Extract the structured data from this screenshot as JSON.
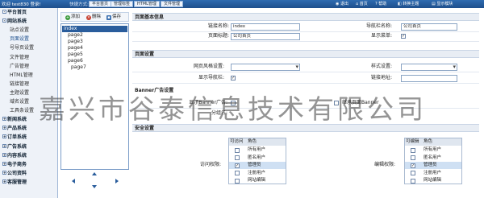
{
  "topbar": {
    "welcome": "欢迎 test830 登录!",
    "quick_label": "快捷方式:",
    "tabs": [
      "平台首页",
      "管理标签",
      "HTML管理",
      "文件管理"
    ],
    "right": [
      "退出",
      "首页",
      "帮助",
      "转换主题",
      "显示模块"
    ]
  },
  "leftnav": {
    "items": [
      {
        "label": "平台首页",
        "type": "top",
        "state": "-"
      },
      {
        "label": "网站系统",
        "type": "top",
        "state": "-"
      },
      {
        "label": "站点设置",
        "type": "sub"
      },
      {
        "label": "页面设置",
        "type": "sub",
        "selected": true
      },
      {
        "label": "号导页设置",
        "type": "sub"
      },
      {
        "label": "文件管理",
        "type": "sub"
      },
      {
        "label": "广告管理",
        "type": "sub"
      },
      {
        "label": "HTML管理",
        "type": "sub"
      },
      {
        "label": "链接管理",
        "type": "sub"
      },
      {
        "label": "主题设置",
        "type": "sub"
      },
      {
        "label": "域名设置",
        "type": "sub"
      },
      {
        "label": "工具条设置",
        "type": "sub"
      },
      {
        "label": "新闻系统",
        "type": "top",
        "state": "+"
      },
      {
        "label": "产品系统",
        "type": "top",
        "state": "+"
      },
      {
        "label": "订单系统",
        "type": "top",
        "state": "+"
      },
      {
        "label": "广告系统",
        "type": "top",
        "state": "+"
      },
      {
        "label": "内容系统",
        "type": "top",
        "state": "+"
      },
      {
        "label": "电子商务",
        "type": "top",
        "state": "+"
      },
      {
        "label": "公司资料",
        "type": "top",
        "state": "+"
      },
      {
        "label": "客服管理",
        "type": "top",
        "state": "+"
      }
    ]
  },
  "toolbar": {
    "add": "添加",
    "delete": "删除",
    "save": "保存"
  },
  "tree": {
    "nodes": [
      "index",
      "page2",
      "page3",
      "page4",
      "page5",
      "page6",
      "page7"
    ]
  },
  "form": {
    "section_basic": "页面基本信息",
    "link_name_label": "链接名称:",
    "link_name_value": "index",
    "nav_name_label": "导航栏名称:",
    "nav_name_value": "公司首页",
    "page_title_label": "页面标题:",
    "page_title_value": "公司首页",
    "show_label": "显示菜单:",
    "section_page": "页面设置",
    "page_style_label": "网页风格设置:",
    "style_label": "样式设置:",
    "show_nav_label": "显示导航栏:",
    "link_addr_label": "链接地址:",
    "section_banner": "Banner广告设置",
    "show_banner_label": "显示Banner广告:",
    "inherit_banner_label": "继承页面Banner",
    "group_label": "分组名:",
    "section_security": "安全设置",
    "access_label": "访问权限:",
    "edit_label": "编辑权限:"
  },
  "access": {
    "headers": [
      "可访问",
      "角色"
    ],
    "rows": [
      {
        "role": "所有用户",
        "checked": false
      },
      {
        "role": "匿名用户",
        "checked": false
      },
      {
        "role": "管理员",
        "checked": true
      },
      {
        "role": "注册用户",
        "checked": false
      },
      {
        "role": "网站编辑",
        "checked": false
      }
    ]
  },
  "edit": {
    "headers": [
      "可编辑",
      "角色"
    ],
    "rows": [
      {
        "role": "所有用户",
        "checked": false
      },
      {
        "role": "匿名用户",
        "checked": false
      },
      {
        "role": "管理员",
        "checked": true
      },
      {
        "role": "注册用户",
        "checked": false
      },
      {
        "role": "网站编辑",
        "checked": false
      }
    ]
  },
  "watermark": "嘉兴市谷泰信息技术有限公司",
  "colors": {
    "topbar": "#1d4f8c",
    "selected": "#2a5d9c",
    "section_bg": "#e8edf4"
  }
}
